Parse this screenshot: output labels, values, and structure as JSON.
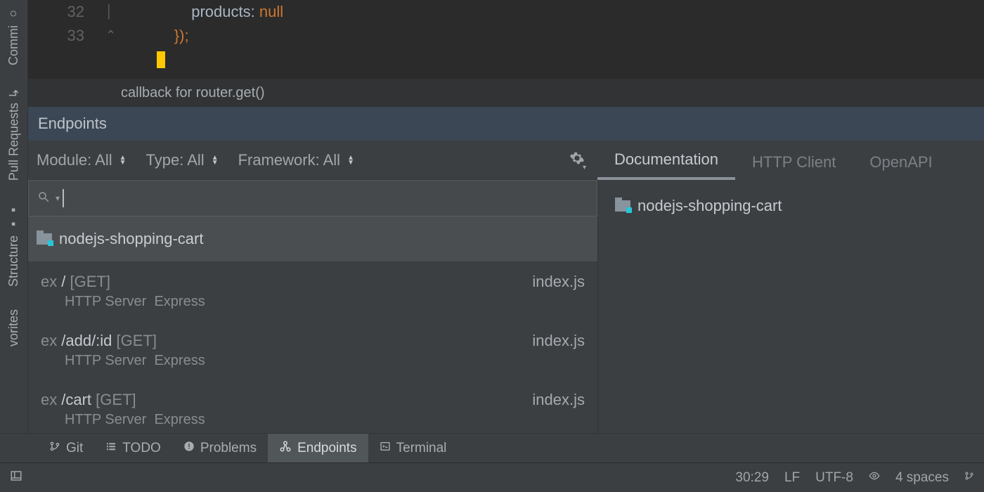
{
  "sidebar_tabs": {
    "commit": "Commi",
    "pull": "Pull Requests",
    "structure": "Structure",
    "favorites": "vorites"
  },
  "editor": {
    "lines": [
      {
        "num": "32",
        "indent": "                    ",
        "key": "products",
        "colon": ": ",
        "value": "null"
      },
      {
        "num": "33",
        "indent": "                ",
        "text": "});"
      },
      {
        "num": "  ",
        "caret": true
      }
    ]
  },
  "hint": "callback for router.get()",
  "panel_title": "Endpoints",
  "filters": {
    "module_label": "Module: All",
    "type_label": "Type: All",
    "framework_label": "Framework: All"
  },
  "right_tabs": {
    "documentation": "Documentation",
    "httpclient": "HTTP Client",
    "openapi": "OpenAPI"
  },
  "project_name": "nodejs-shopping-cart",
  "endpoints": [
    {
      "path": "/",
      "method": "[GET]",
      "file": "index.js",
      "server": "HTTP Server",
      "framework": "Express"
    },
    {
      "path": "/add/:id",
      "method": "[GET]",
      "file": "index.js",
      "server": "HTTP Server",
      "framework": "Express"
    },
    {
      "path": "/cart",
      "method": "[GET]",
      "file": "index.js",
      "server": "HTTP Server",
      "framework": "Express"
    }
  ],
  "doc_pane": {
    "project": "nodejs-shopping-cart"
  },
  "bottom_bar": {
    "git": "Git",
    "todo": "TODO",
    "problems": "Problems",
    "endpoints": "Endpoints",
    "terminal": "Terminal"
  },
  "status": {
    "pos": "30:29",
    "eol": "LF",
    "encoding": "UTF-8",
    "indent": "4 spaces"
  }
}
